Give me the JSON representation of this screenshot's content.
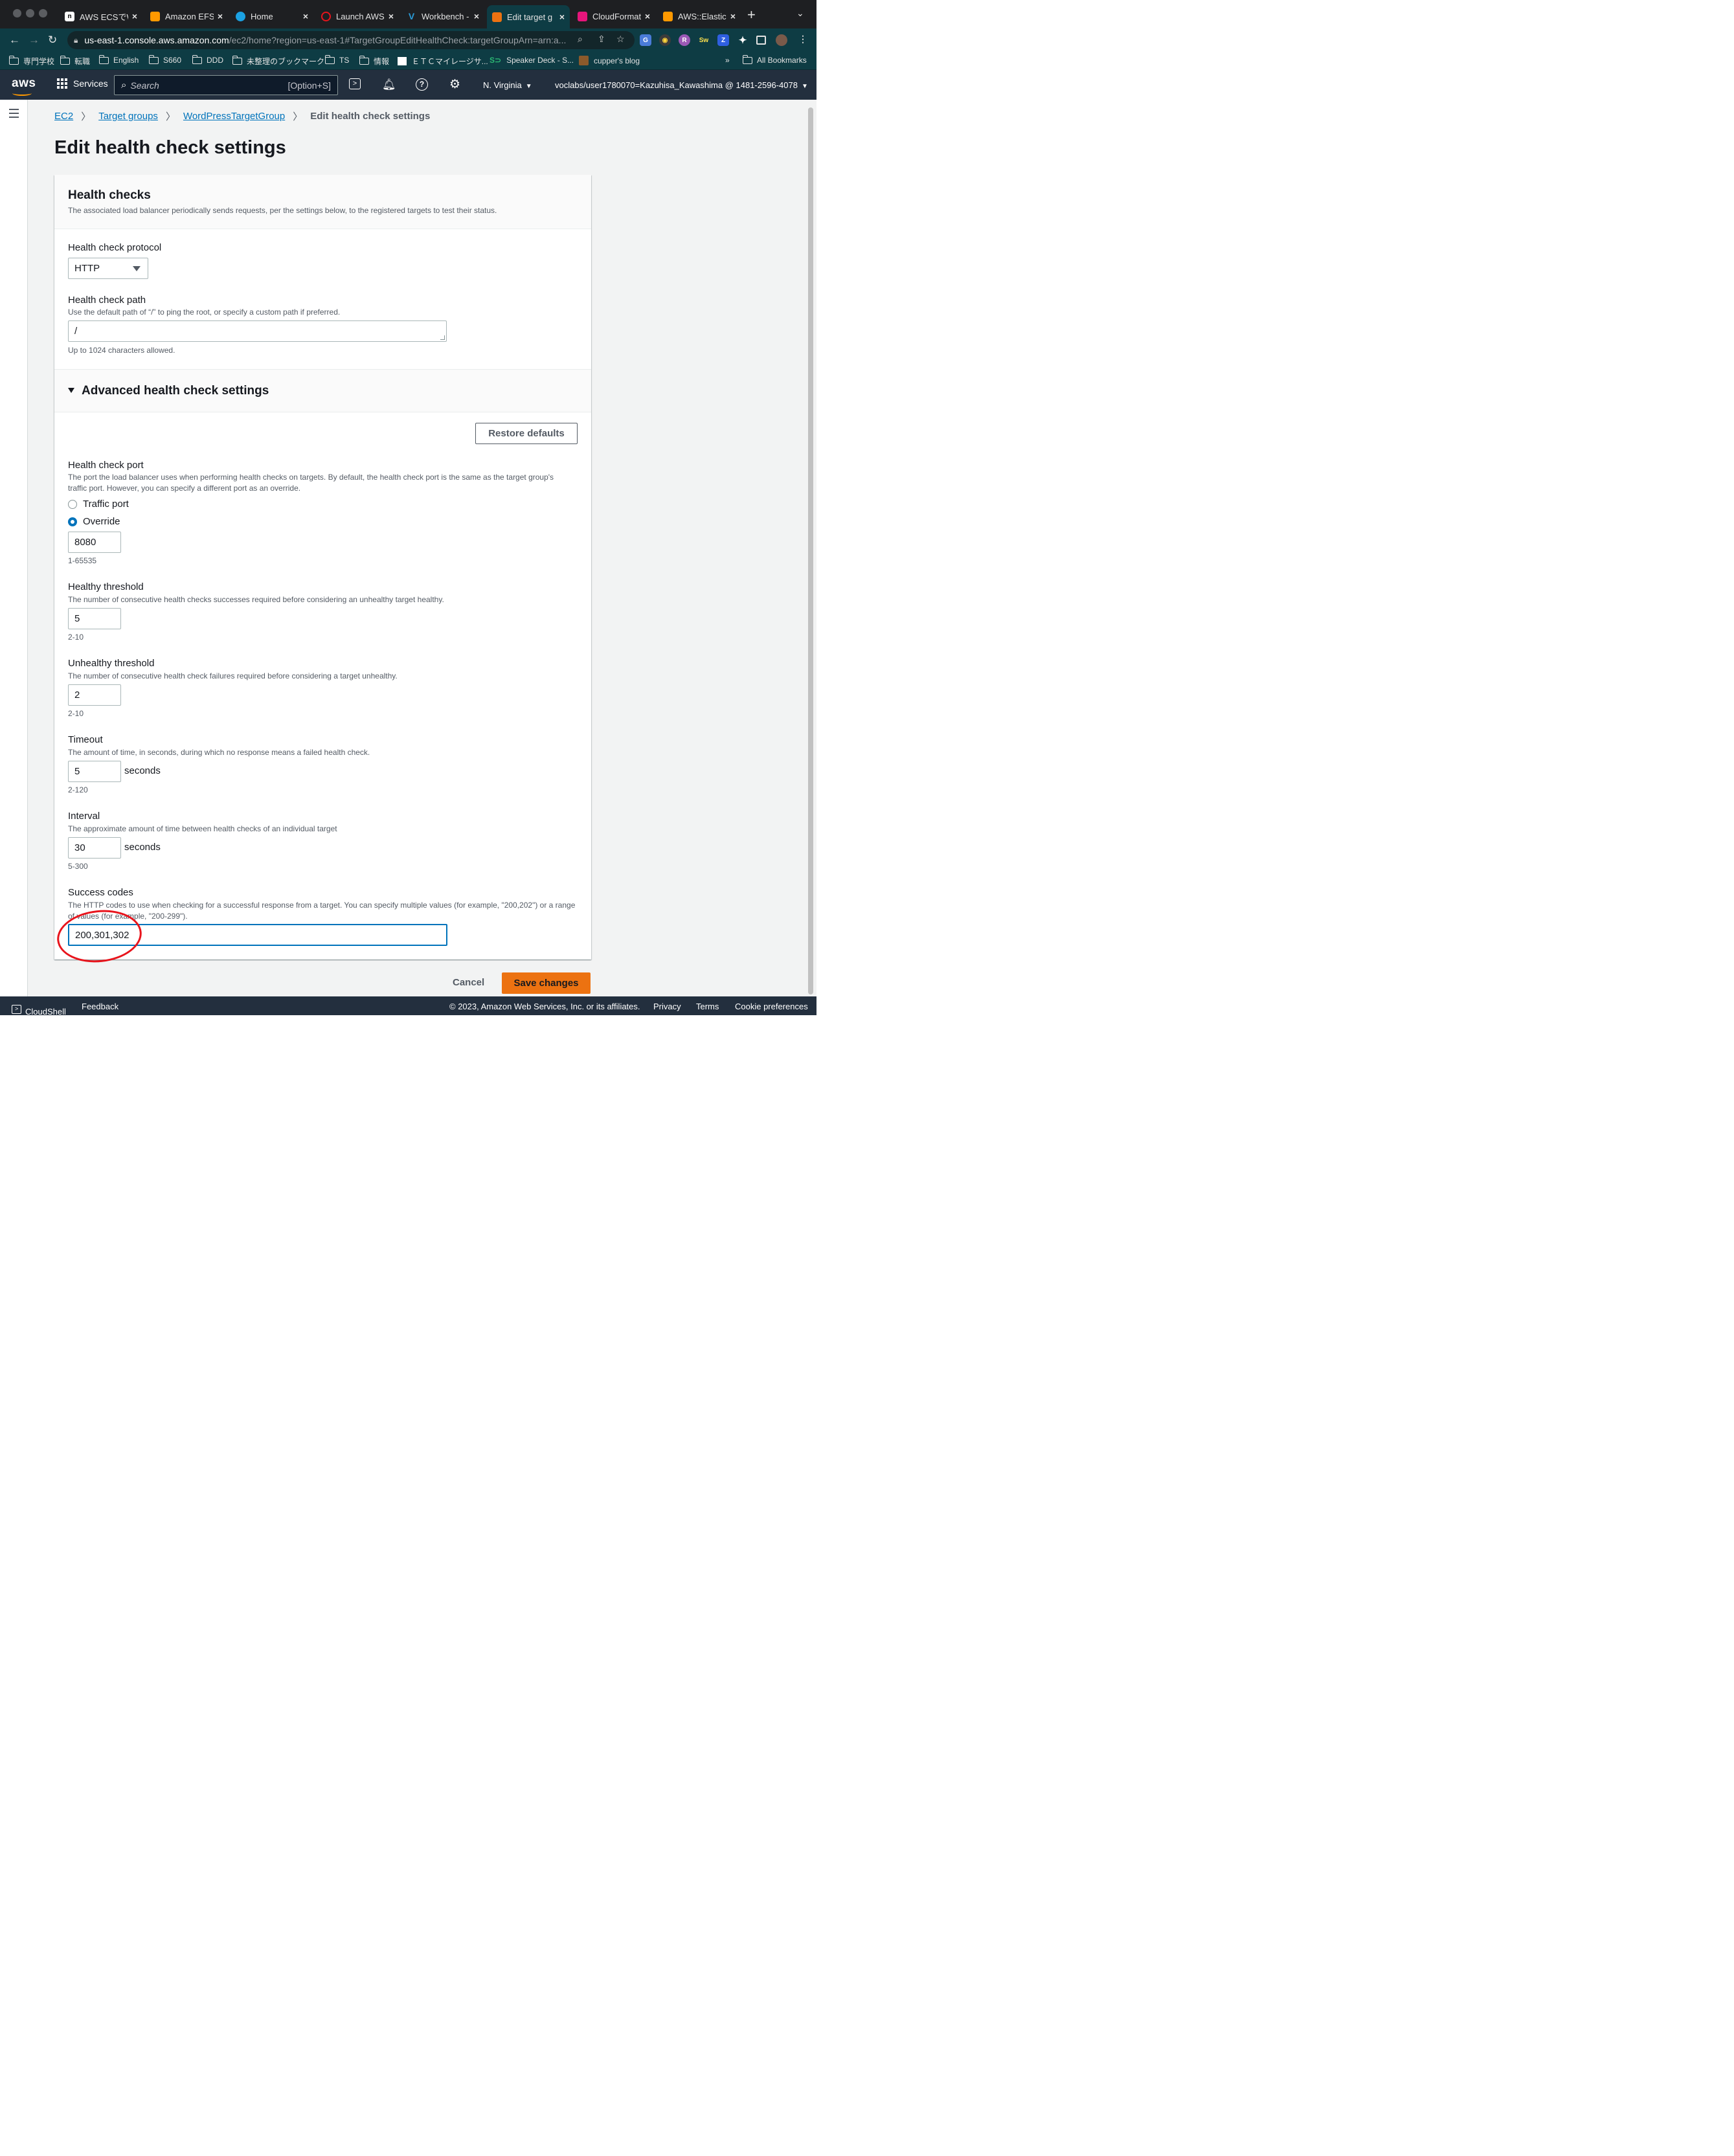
{
  "browser": {
    "tabs": [
      {
        "title": "AWS ECSでW",
        "favicon_color": "#ffffff"
      },
      {
        "title": "Amazon EFS",
        "favicon_color": "#ff9900"
      },
      {
        "title": "Home",
        "favicon_color": "#1ba1e2"
      },
      {
        "title": "Launch AWS",
        "favicon_color": "#e8141c"
      },
      {
        "title": "Workbench -",
        "favicon_color": "#2a9bd8"
      },
      {
        "title": "Edit target g",
        "favicon_color": "#ec7211"
      },
      {
        "title": "CloudFormat",
        "favicon_color": "#e7157b"
      },
      {
        "title": "AWS::Elastic",
        "favicon_color": "#ff9900"
      }
    ],
    "active_tab_index": 5,
    "url_host": "us-east-1.console.aws.amazon.com",
    "url_path": "/ec2/home?region=us-east-1#TargetGroupEditHealthCheck:targetGroupArn=arn:a...",
    "bookmarks": [
      "専門学校",
      "転職",
      "English",
      "S660",
      "DDD",
      "未整理のブックマーク",
      "TS",
      "情報",
      "ＥＴＣマイレージサ...",
      "Speaker Deck - S...",
      "cupper's blog"
    ],
    "bookmarks_overflow": "»",
    "all_bookmarks": "All Bookmarks"
  },
  "aws_header": {
    "logo": "aws",
    "services_label": "Services",
    "search_placeholder": "Search",
    "search_shortcut": "[Option+S]",
    "region": "N. Virginia",
    "account": "voclabs/user1780070=Kazuhisa_Kawashima @ 1481-2596-4078"
  },
  "breadcrumbs": [
    {
      "label": "EC2",
      "link": true
    },
    {
      "label": "Target groups",
      "link": true
    },
    {
      "label": "WordPressTargetGroup",
      "link": true
    },
    {
      "label": "Edit health check settings",
      "link": false
    }
  ],
  "page_title": "Edit health check settings",
  "health_checks": {
    "title": "Health checks",
    "description": "The associated load balancer periodically sends requests, per the settings below, to the registered targets to test their status.",
    "protocol_label": "Health check protocol",
    "protocol_value": "HTTP",
    "path_label": "Health check path",
    "path_description": "Use the default path of “/” to ping the root, or specify a custom path if preferred.",
    "path_value": "/",
    "path_constraint": "Up to 1024 characters allowed."
  },
  "advanced": {
    "title": "Advanced health check settings",
    "restore_defaults_label": "Restore defaults",
    "port_label": "Health check port",
    "port_description": "The port the load balancer uses when performing health checks on targets. By default, the health check port is the same as the target group's traffic port. However, you can specify a different port as an override.",
    "port_options": [
      "Traffic port",
      "Override"
    ],
    "port_selected": "Override",
    "port_value": "8080",
    "port_constraint": "1-65535",
    "healthy_label": "Healthy threshold",
    "healthy_description": "The number of consecutive health checks successes required before considering an unhealthy target healthy.",
    "healthy_value": "5",
    "healthy_constraint": "2-10",
    "unhealthy_label": "Unhealthy threshold",
    "unhealthy_description": "The number of consecutive health check failures required before considering a target unhealthy.",
    "unhealthy_value": "2",
    "unhealthy_constraint": "2-10",
    "timeout_label": "Timeout",
    "timeout_description": "The amount of time, in seconds, during which no response means a failed health check.",
    "timeout_value": "5",
    "timeout_unit": "seconds",
    "timeout_constraint": "2-120",
    "interval_label": "Interval",
    "interval_description": "The approximate amount of time between health checks of an individual target",
    "interval_value": "30",
    "interval_unit": "seconds",
    "interval_constraint": "5-300",
    "success_label": "Success codes",
    "success_description": "The HTTP codes to use when checking for a successful response from a target. You can specify multiple values (for example, \"200,202\") or a range of values (for example, \"200-299\").",
    "success_value": "200,301,302"
  },
  "actions": {
    "cancel_label": "Cancel",
    "save_label": "Save changes"
  },
  "footer": {
    "cloudshell": "CloudShell",
    "feedback": "Feedback",
    "copyright": "© 2023, Amazon Web Services, Inc. or its affiliates.",
    "privacy": "Privacy",
    "terms": "Terms",
    "cookies": "Cookie preferences"
  },
  "colors": {
    "aws_header": "#232f3e",
    "link": "#0073bb",
    "primary_button": "#ec7211",
    "annotation": "#e8141c"
  }
}
